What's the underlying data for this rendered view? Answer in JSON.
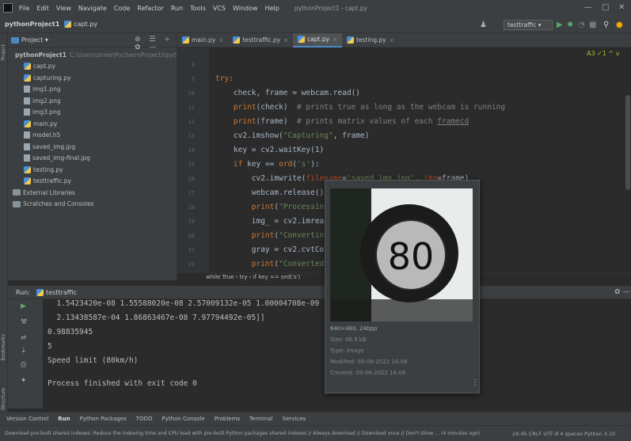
{
  "menu": {
    "items": [
      "File",
      "Edit",
      "View",
      "Navigate",
      "Code",
      "Refactor",
      "Run",
      "Tools",
      "VCS",
      "Window",
      "Help"
    ],
    "window_title": "pythonProject1 - capt.py",
    "controls": [
      "—",
      "□",
      "✕"
    ]
  },
  "navbar": {
    "project": "pythonProject1",
    "file": "capt.py",
    "run_config": "testtraffic ▾"
  },
  "strip_labels": {
    "project": "Project",
    "bookmarks": "Bookmarks",
    "structure": "Structure"
  },
  "project_panel": {
    "title": "Project ▾",
    "header_icons": "⊕ ☰ ÷ ✿ —",
    "tree": [
      {
        "label": "pythonProject1",
        "path": "C:\\Users\\shree\\PycharmProjects\\pyth",
        "type": "folder",
        "indent": 0
      },
      {
        "label": "capt.py",
        "type": "py",
        "indent": 1
      },
      {
        "label": "capturing.py",
        "type": "py",
        "indent": 1
      },
      {
        "label": "img1.png",
        "type": "file",
        "indent": 1
      },
      {
        "label": "img2.png",
        "type": "file",
        "indent": 1
      },
      {
        "label": "img3.png",
        "type": "file",
        "indent": 1
      },
      {
        "label": "main.py",
        "type": "py",
        "indent": 1
      },
      {
        "label": "model.h5",
        "type": "file",
        "indent": 1
      },
      {
        "label": "saved_img.jpg",
        "type": "file",
        "indent": 1
      },
      {
        "label": "saved_img-final.jpg",
        "type": "file",
        "indent": 1
      },
      {
        "label": "testing.py",
        "type": "py",
        "indent": 1
      },
      {
        "label": "testtraffic.py",
        "type": "py",
        "indent": 1
      },
      {
        "label": "External Libraries",
        "type": "folder",
        "indent": 0
      },
      {
        "label": "Scratches and Consoles",
        "type": "folder",
        "indent": 0
      }
    ]
  },
  "tabs": [
    {
      "label": "main.py",
      "active": false
    },
    {
      "label": "testtraffic.py",
      "active": false
    },
    {
      "label": "capt.py",
      "active": true
    },
    {
      "label": "testing.py",
      "active": false
    }
  ],
  "editor": {
    "markers": "A3 ✓1 ^ v",
    "line_numbers": [
      "8",
      "9",
      "10",
      "11",
      "12",
      "13",
      "14",
      "15",
      "16",
      "17",
      "18",
      "19",
      "20",
      "21",
      "22",
      "23"
    ],
    "breadcrumb": "while True  ›  try  ›  if key == ord('s')"
  },
  "run_panel": {
    "label": "Run:",
    "config": "testtraffic",
    "console": [
      "  1.5423420e-08 1.55588020e-08 2.57009132e-05 1.00004708e-09",
      "  2.13438587e-04 1.86863467e-08 7.97794492e-05]]",
      "0.98835945",
      "5",
      "Speed limit (80km/h)",
      "",
      "Process finished with exit code 0"
    ]
  },
  "preview": {
    "sign_text": "80",
    "dimensions": "640×480, 24bpp",
    "size": "Size: 46.9 kB",
    "type": "Type: Image",
    "modified": "Modified: 09-06-2022 16:08",
    "created": "Created: 09-06-2022 16:08"
  },
  "toolwindows": [
    "Version Control",
    "Run",
    "Python Packages",
    "TODO",
    "Python Console",
    "Problems",
    "Terminal",
    "Services"
  ],
  "status": {
    "message": "Download pre-built shared indexes: Reduce the indexing time and CPU load with pre-built Python packages shared indexes // Always download // Download once // Don't show ... (4 minutes ago)",
    "right": "24:45  CRLF  UTF-8  4 spaces  Python 3.10"
  },
  "colors": {
    "keyword": "#cc7832",
    "string": "#6a8759",
    "comment": "#808080",
    "accent": "#4a88c7",
    "run_green": "#59a869"
  }
}
